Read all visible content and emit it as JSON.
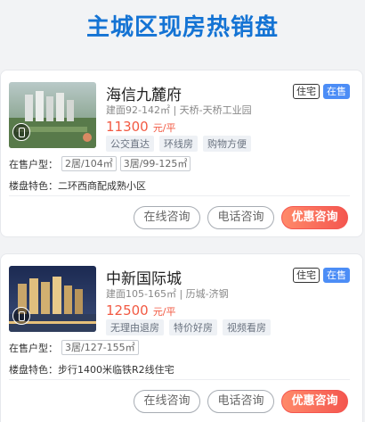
{
  "page_title": "主城区现房热销盘",
  "listings": [
    {
      "name": "海信九麓府",
      "type_badge": "住宅",
      "status_badge": "在售",
      "meta": "建面92-142㎡ | 天桥-天桥工业园",
      "price_value": "11300",
      "price_unit": "元/平",
      "tags": [
        "公交直达",
        "环线房",
        "购物方便"
      ],
      "layouts_label": "在售户型：",
      "layouts": [
        "2居/104㎡",
        "3居/99-125㎡"
      ],
      "feature": "楼盘特色：二环西商配成熟小区",
      "buttons": {
        "online": "在线咨询",
        "phone": "电话咨询",
        "discount": "优惠咨询"
      }
    },
    {
      "name": "中新国际城",
      "type_badge": "住宅",
      "status_badge": "在售",
      "meta": "建面105-165㎡ | 历城-济钢",
      "price_value": "12500",
      "price_unit": "元/平",
      "tags": [
        "无理由退房",
        "特价好房",
        "视频看房"
      ],
      "layouts_label": "在售户型：",
      "layouts": [
        "3居/127-155㎡"
      ],
      "feature": "楼盘特色：步行1400米临铁R2线住宅",
      "buttons": {
        "online": "在线咨询",
        "phone": "电话咨询",
        "discount": "优惠咨询"
      }
    }
  ],
  "colors": {
    "title": "#1473d4",
    "price": "#f25a43",
    "sale_badge": "#4c8df6",
    "primary_button": "#f4564f"
  },
  "icons": {
    "tour": "vr-tour-icon"
  }
}
